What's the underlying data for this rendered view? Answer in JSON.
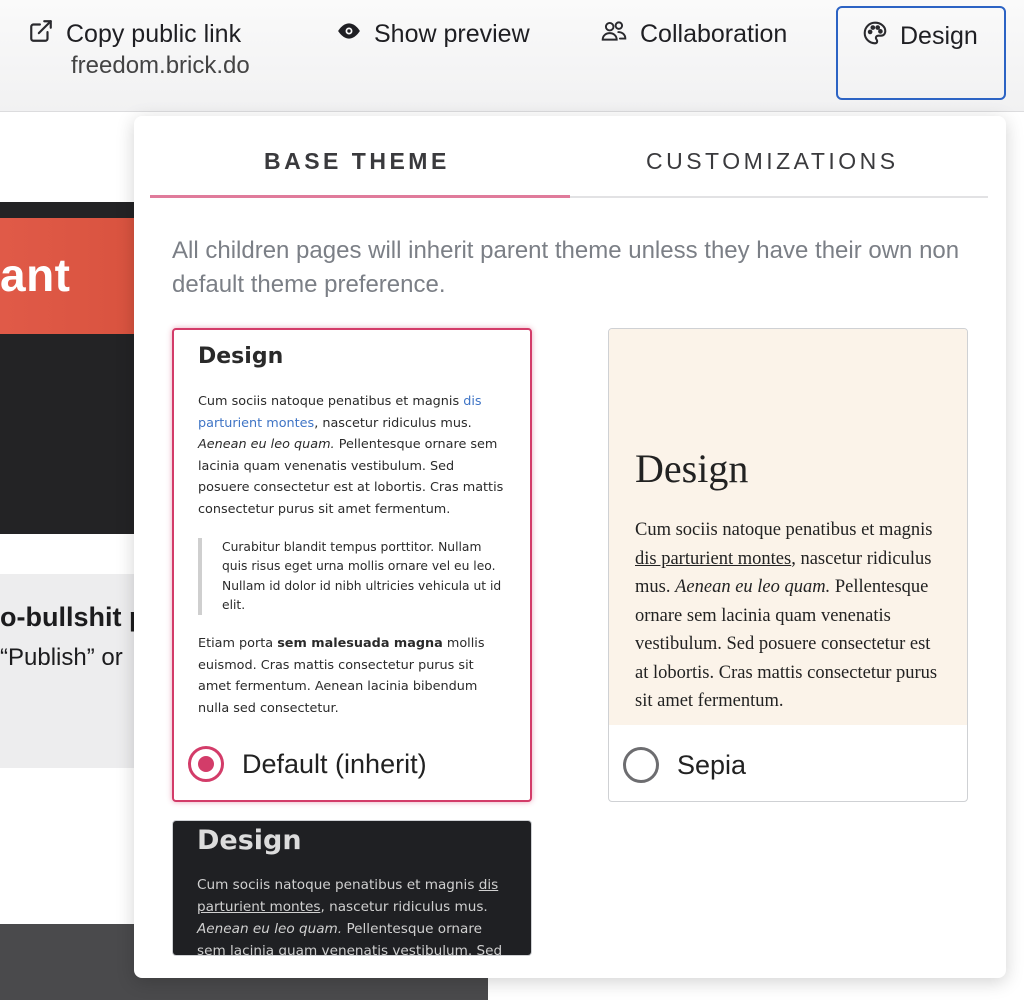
{
  "toolbar": {
    "copy_link_label": "Copy public link",
    "copy_link_url": "freedom.brick.do",
    "preview_label": "Show preview",
    "collab_label": "Collaboration",
    "design_label": "Design"
  },
  "background": {
    "heading_fragment": "ant",
    "bold_fragment": "o-bullshit p",
    "text_fragment": "“Publish” or"
  },
  "popover": {
    "tabs": [
      "BASE THEME",
      "CUSTOMIZATIONS"
    ],
    "active_tab": "BASE THEME",
    "description": "All children pages will inherit parent theme unless they have their own non default theme preference."
  },
  "themes": {
    "default": {
      "label": "Default (inherit)",
      "selected": true,
      "preview": {
        "heading": "Design",
        "p1_a": "Cum sociis natoque penatibus et magnis ",
        "p1_link": "dis parturient montes",
        "p1_b": ", nascetur ridiculus mus. ",
        "p1_em": "Aenean eu leo quam.",
        "p1_c": " Pellentesque ornare sem lacinia quam venenatis vestibulum. Sed posuere consectetur est at lobortis. Cras mattis consectetur purus sit amet fermentum.",
        "quote": "Curabitur blandit tempus porttitor. Nullam quis risus eget urna mollis ornare vel eu leo. Nullam id dolor id nibh ultricies vehicula ut id elit.",
        "p2_a": "Etiam porta ",
        "p2_strong": "sem malesuada magna",
        "p2_b": " mollis euismod. Cras mattis consectetur purus sit amet fermentum. Aenean lacinia bibendum nulla sed consectetur."
      }
    },
    "sepia": {
      "label": "Sepia",
      "selected": false,
      "preview": {
        "heading": "Design",
        "p1_a": "Cum sociis natoque penatibus et magnis ",
        "p1_link": "dis parturient montes",
        "p1_b": ", nascetur ridiculus mus. ",
        "p1_em": "Aenean eu leo quam.",
        "p1_c": " Pellentesque ornare sem lacinia quam venenatis vestibulum. Sed posuere consectetur est at lobortis. Cras mattis consectetur purus sit amet fermentum."
      }
    },
    "dark": {
      "preview": {
        "heading": "Design",
        "p1_a": "Cum sociis natoque penatibus et magnis ",
        "p1_link": "dis parturient montes",
        "p1_b": ", nascetur ridiculus mus. ",
        "p1_em": "Aenean eu leo quam.",
        "p1_c": " Pellentesque ornare sem lacinia quam venenatis vestibulum. Sed posuere"
      }
    }
  },
  "colors": {
    "accent": "#d33c69",
    "tab_indicator": "#e07b9b",
    "focus_border": "#2c63c4",
    "sepia_bg": "#fbf3e9",
    "dark_bg": "#1f2023"
  },
  "icons": [
    "external-link-icon",
    "eye-icon",
    "users-icon",
    "palette-icon"
  ]
}
